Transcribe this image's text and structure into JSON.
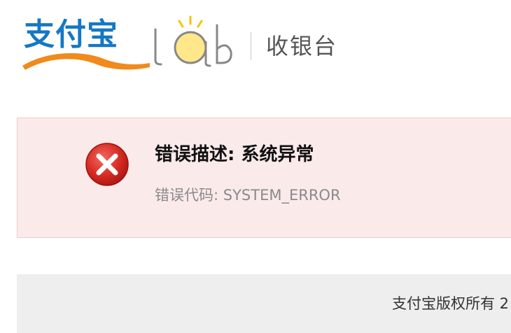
{
  "header": {
    "brand": "支付宝",
    "lab_logo": "lab",
    "title": "收银台"
  },
  "error": {
    "title": "错误描述: 系统异常",
    "code_label": "错误代码:",
    "code_value": "SYSTEM_ERROR",
    "icon": "error-x-icon"
  },
  "footer": {
    "copyright": "支付宝版权所有 2"
  },
  "colors": {
    "brand_blue": "#1577c5",
    "brand_orange": "#f08a1c",
    "error_bg": "#fbeaea",
    "error_icon_red": "#d62a22",
    "footer_bg": "#eeeeee"
  }
}
